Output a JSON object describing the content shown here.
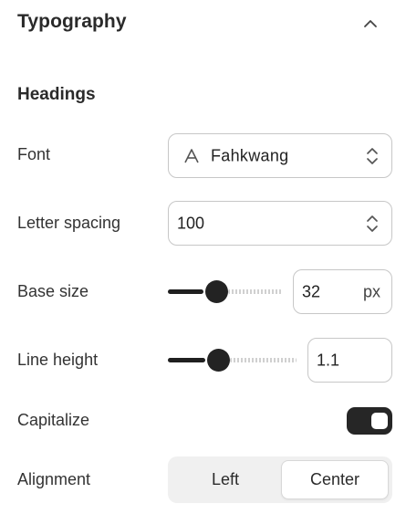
{
  "section": {
    "title": "Typography"
  },
  "headings": {
    "title": "Headings",
    "font": {
      "label": "Font",
      "value": "Fahkwang"
    },
    "letter_spacing": {
      "label": "Letter spacing",
      "value": "100"
    },
    "base_size": {
      "label": "Base size",
      "value": "32",
      "unit": "px",
      "slider_fraction": 0.31
    },
    "line_height": {
      "label": "Line height",
      "value": "1.1",
      "slider_fraction": 0.29
    },
    "capitalize": {
      "label": "Capitalize",
      "enabled": true
    },
    "alignment": {
      "label": "Alignment",
      "options": [
        "Left",
        "Center"
      ],
      "selected": "Center"
    }
  },
  "colors": {
    "accent": "#262626",
    "border": "#c7c7c7",
    "segment_bg": "#f0f0f0"
  }
}
